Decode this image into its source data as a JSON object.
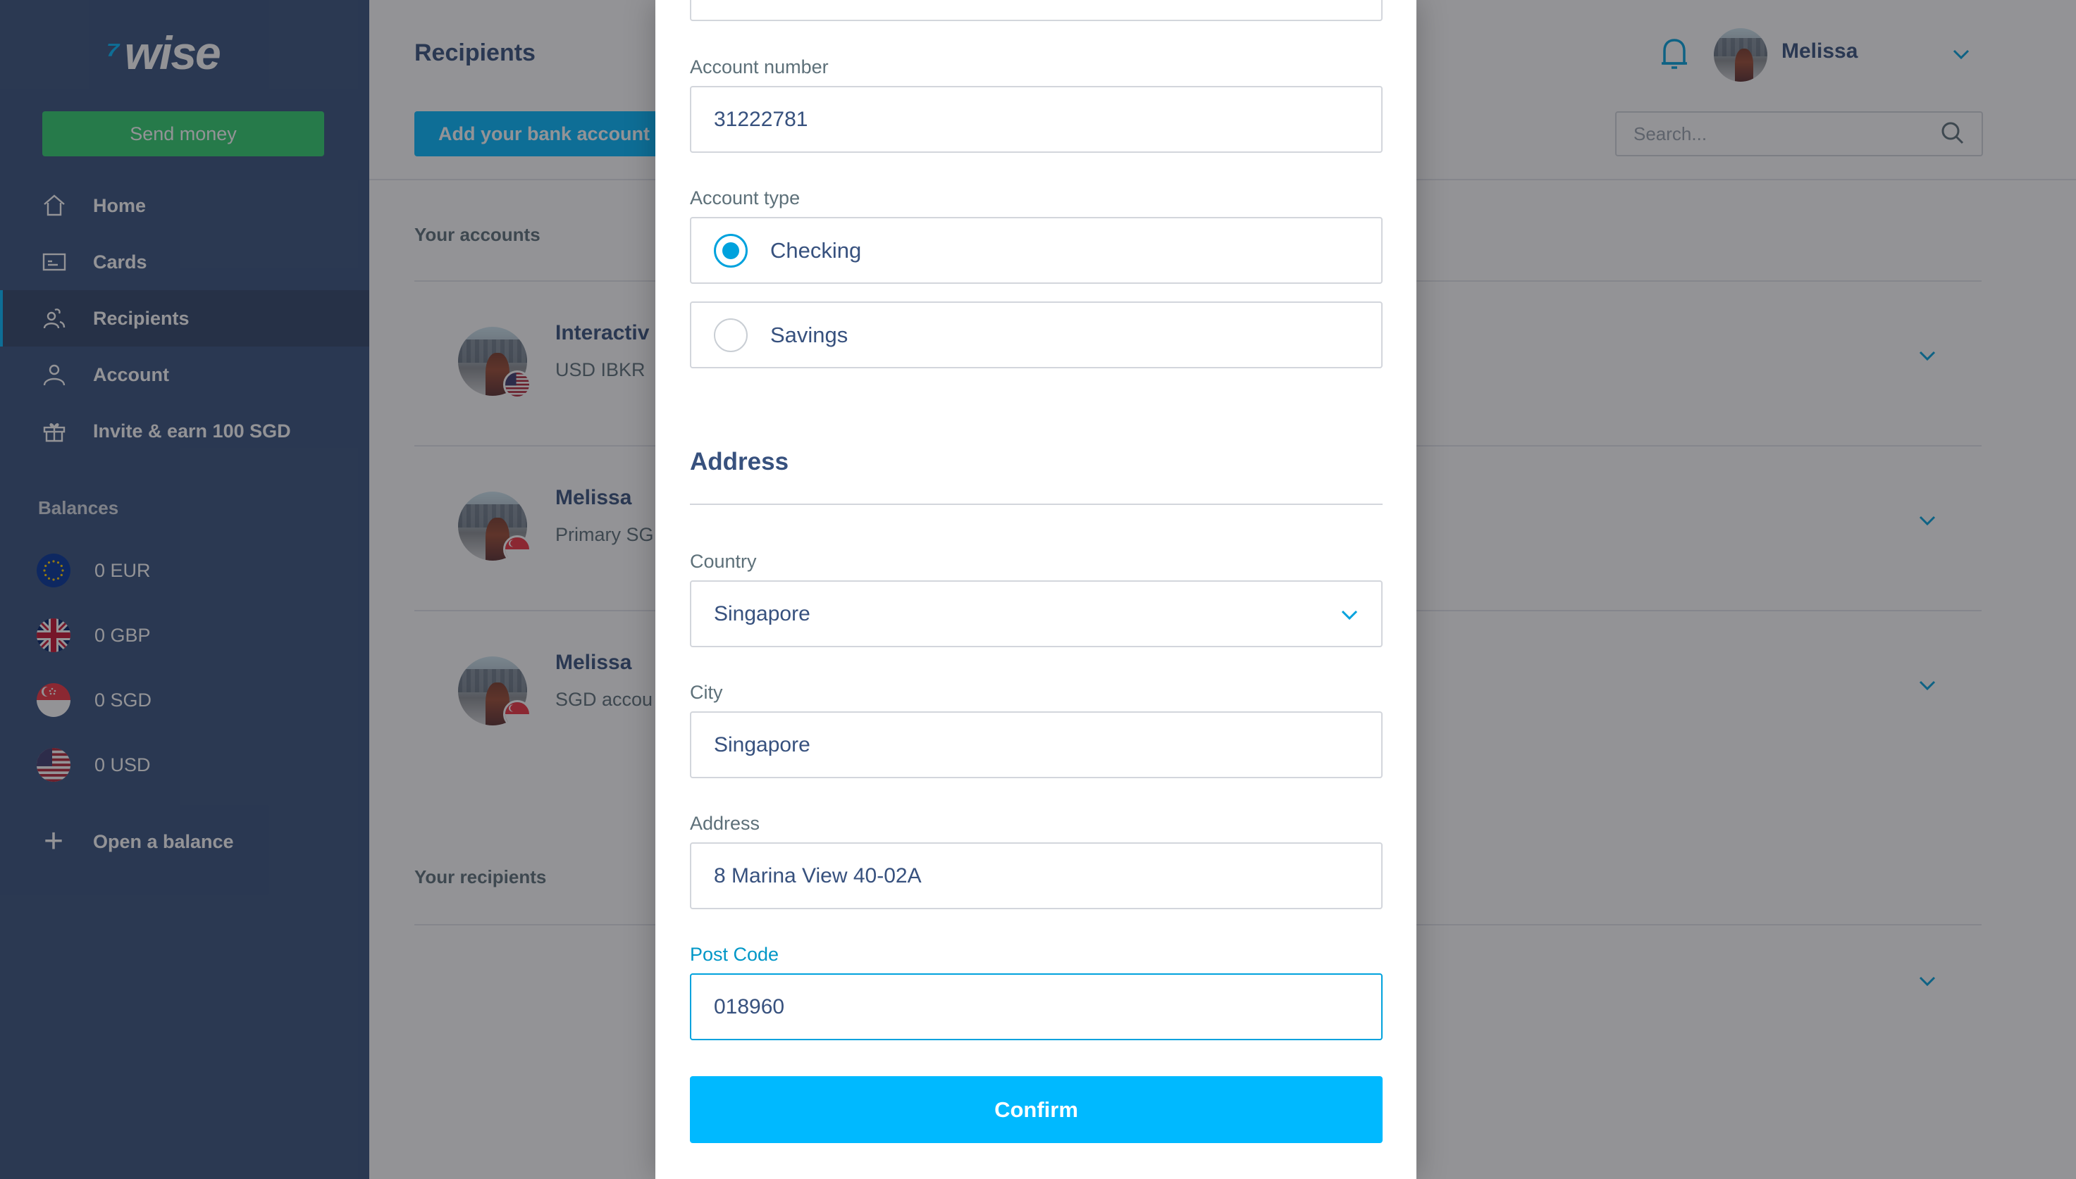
{
  "sidebar": {
    "logo_text": "wise",
    "send_money_label": "Send money",
    "nav": [
      {
        "label": "Home",
        "icon": "home-icon",
        "active": false
      },
      {
        "label": "Cards",
        "icon": "card-icon",
        "active": false
      },
      {
        "label": "Recipients",
        "icon": "recipients-icon",
        "active": true
      },
      {
        "label": "Account",
        "icon": "account-icon",
        "active": false
      },
      {
        "label": "Invite & earn 100 SGD",
        "icon": "gift-icon",
        "active": false
      }
    ],
    "balances_title": "Balances",
    "balances": [
      {
        "label": "0 EUR",
        "flag": "eu-flag-icon"
      },
      {
        "label": "0 GBP",
        "flag": "uk-flag-icon"
      },
      {
        "label": "0 SGD",
        "flag": "sg-flag-icon"
      },
      {
        "label": "0 USD",
        "flag": "us-flag-icon"
      }
    ],
    "open_balance_label": "Open a balance"
  },
  "header": {
    "page_title": "Recipients",
    "add_bank_label": "Add your bank account",
    "user_name": "Melissa",
    "search_placeholder": "Search..."
  },
  "accounts": {
    "section_label": "Your accounts",
    "items": [
      {
        "name": "Interactiv",
        "sub": "USD IBKR",
        "flag": "us-flag-icon"
      },
      {
        "name": "Melissa",
        "sub": "Primary SG",
        "flag": "sg-flag-icon"
      },
      {
        "name": "Melissa",
        "sub": "SGD accou",
        "flag": "sg-flag-icon"
      }
    ]
  },
  "recipients": {
    "section_label": "Your recipients"
  },
  "modal": {
    "account_number_label": "Account number",
    "account_number_value": "31222781",
    "account_type_label": "Account type",
    "account_type_options": [
      {
        "label": "Checking",
        "selected": true
      },
      {
        "label": "Savings",
        "selected": false
      }
    ],
    "address_title": "Address",
    "country_label": "Country",
    "country_value": "Singapore",
    "city_label": "City",
    "city_value": "Singapore",
    "address_label": "Address",
    "address_value": "8 Marina View 40-02A",
    "postcode_label": "Post Code",
    "postcode_value": "018960",
    "confirm_label": "Confirm"
  },
  "colors": {
    "sidebar_bg": "#37517e",
    "brand_blue": "#00b9ff",
    "send_green": "#2ed06e",
    "text_navy": "#37517e"
  }
}
